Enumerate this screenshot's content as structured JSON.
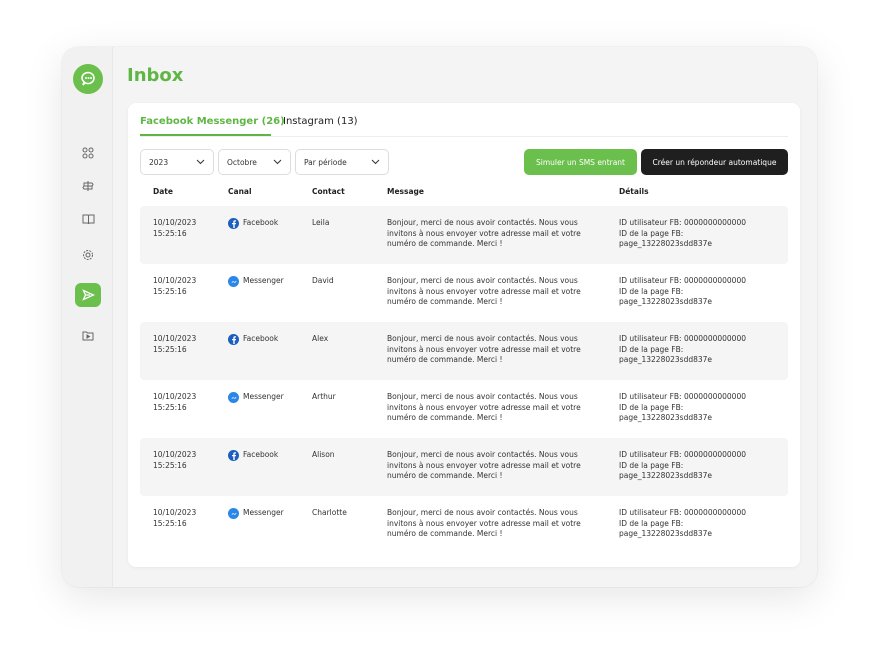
{
  "page_title": "Inbox",
  "tabs": [
    {
      "label": "Facebook Messenger (26)",
      "active": true
    },
    {
      "label": "Instagram (13)",
      "active": false
    }
  ],
  "filters": {
    "year": "2023",
    "month": "Octobre",
    "period": "Par période"
  },
  "buttons": {
    "simulate": "Simuler un SMS entrant",
    "create": "Créer un répondeur automatique"
  },
  "table": {
    "headers": [
      "Date",
      "Canal",
      "Contact",
      "Message",
      "Détails"
    ],
    "rows": [
      {
        "date": "10/10/2023",
        "time": "15:25:16",
        "canal": "Facebook",
        "icon": "facebook-icon",
        "contact": "Leila",
        "msg1": "Bonjour, merci de nous avoir contactés. Nous vous",
        "msg2": "invitons à nous envoyer votre adresse mail et votre",
        "msg3": "numéro de commande. Merci !",
        "d1": "ID utilisateur FB: 0000000000000",
        "d2": "ID de la page FB:",
        "d3": "page_13228023sdd837e"
      },
      {
        "date": "10/10/2023",
        "time": "15:25:16",
        "canal": "Messenger",
        "icon": "messenger-icon",
        "contact": "David",
        "msg1": "Bonjour, merci de nous avoir contactés. Nous vous",
        "msg2": "invitons à nous envoyer votre adresse mail et votre",
        "msg3": "numéro de commande. Merci !",
        "d1": "ID utilisateur FB: 0000000000000",
        "d2": "ID de la page FB:",
        "d3": "page_13228023sdd837e"
      },
      {
        "date": "10/10/2023",
        "time": "15:25:16",
        "canal": "Facebook",
        "icon": "facebook-icon",
        "contact": "Alex",
        "msg1": "Bonjour, merci de nous avoir contactés. Nous vous",
        "msg2": "invitons à nous envoyer votre adresse mail et votre",
        "msg3": "numéro de commande. Merci !",
        "d1": "ID utilisateur FB: 0000000000000",
        "d2": "ID de la page FB:",
        "d3": "page_13228023sdd837e"
      },
      {
        "date": "10/10/2023",
        "time": "15:25:16",
        "canal": "Messenger",
        "icon": "messenger-icon",
        "contact": "Arthur",
        "msg1": "Bonjour, merci de nous avoir contactés. Nous vous",
        "msg2": "invitons à nous envoyer votre adresse mail et votre",
        "msg3": "numéro de commande. Merci !",
        "d1": "ID utilisateur FB: 0000000000000",
        "d2": "ID de la page FB:",
        "d3": "page_13228023sdd837e"
      },
      {
        "date": "10/10/2023",
        "time": "15:25:16",
        "canal": "Facebook",
        "icon": "facebook-icon",
        "contact": "Alison",
        "msg1": "Bonjour, merci de nous avoir contactés. Nous vous",
        "msg2": "invitons à nous envoyer votre adresse mail et votre",
        "msg3": "numéro de commande. Merci !",
        "d1": "ID utilisateur FB: 0000000000000",
        "d2": "ID de la page FB:",
        "d3": "page_13228023sdd837e"
      },
      {
        "date": "10/10/2023",
        "time": "15:25:16",
        "canal": "Messenger",
        "icon": "messenger-icon",
        "contact": "Charlotte",
        "msg1": "Bonjour, merci de nous avoir contactés. Nous vous",
        "msg2": "invitons à nous envoyer votre adresse mail et votre",
        "msg3": "numéro de commande. Merci !",
        "d1": "ID utilisateur FB: 0000000000000",
        "d2": "ID de la page FB:",
        "d3": "page_13228023sdd837e"
      }
    ]
  },
  "sidebar": {
    "logo": "chat-bubble-logo-icon",
    "items": [
      {
        "icon": "grid-icon",
        "active": false
      },
      {
        "icon": "signpost-icon",
        "active": false
      },
      {
        "icon": "book-icon",
        "active": false
      },
      {
        "icon": "gear-icon",
        "active": false
      },
      {
        "icon": "send-icon",
        "active": true
      },
      {
        "icon": "folder-play-icon",
        "active": false
      }
    ]
  },
  "colors": {
    "accent": "#5fb645",
    "button_green": "#6bbf4c",
    "button_dark": "#1f1f1f",
    "facebook": "#1c5fbf",
    "messenger": "#2a86e8"
  }
}
